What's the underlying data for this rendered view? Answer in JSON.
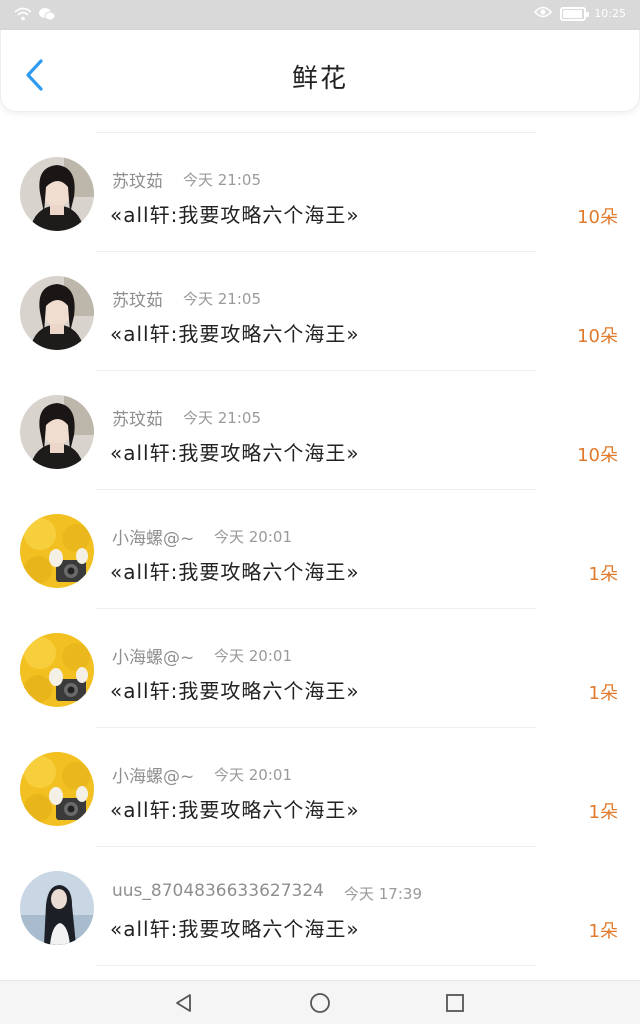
{
  "status_bar": {
    "time": "10:25",
    "battery_level": 0.85,
    "icons": [
      "wifi-icon",
      "wechat-icon",
      "eye-icon",
      "battery-icon"
    ]
  },
  "header": {
    "title": "鲜花",
    "back_icon": "chevron-left-icon"
  },
  "colors": {
    "accent": "#2e9bf0",
    "amount": "#e07b2e",
    "name": "#8f8f8f",
    "message": "#222222"
  },
  "records": [
    {
      "name": "苏玟茹",
      "time": "今天 21:05",
      "message": "«all轩:我要攻略六个海王»",
      "amount": "10朵",
      "avatar": "girl-portrait-avatar"
    },
    {
      "name": "苏玟茹",
      "time": "今天 21:05",
      "message": "«all轩:我要攻略六个海王»",
      "amount": "10朵",
      "avatar": "girl-portrait-avatar"
    },
    {
      "name": "苏玟茹",
      "time": "今天 21:05",
      "message": "«all轩:我要攻略六个海王»",
      "amount": "10朵",
      "avatar": "girl-portrait-avatar"
    },
    {
      "name": "小海螺@~",
      "time": "今天 20:01",
      "message": "«all轩:我要攻略六个海王»",
      "amount": "1朵",
      "avatar": "yellow-camera-avatar"
    },
    {
      "name": "小海螺@~",
      "time": "今天 20:01",
      "message": "«all轩:我要攻略六个海王»",
      "amount": "1朵",
      "avatar": "yellow-camera-avatar"
    },
    {
      "name": "小海螺@~",
      "time": "今天 20:01",
      "message": "«all轩:我要攻略六个海王»",
      "amount": "1朵",
      "avatar": "yellow-camera-avatar"
    },
    {
      "name": "uus_87048366336273​24",
      "time": "今天 17:39",
      "message": "«all轩:我要攻略六个海王»",
      "amount": "1朵",
      "avatar": "long-hair-girl-avatar"
    }
  ],
  "nav_bar": {
    "buttons": [
      "back-triangle-icon",
      "home-circle-icon",
      "recents-square-icon"
    ]
  }
}
